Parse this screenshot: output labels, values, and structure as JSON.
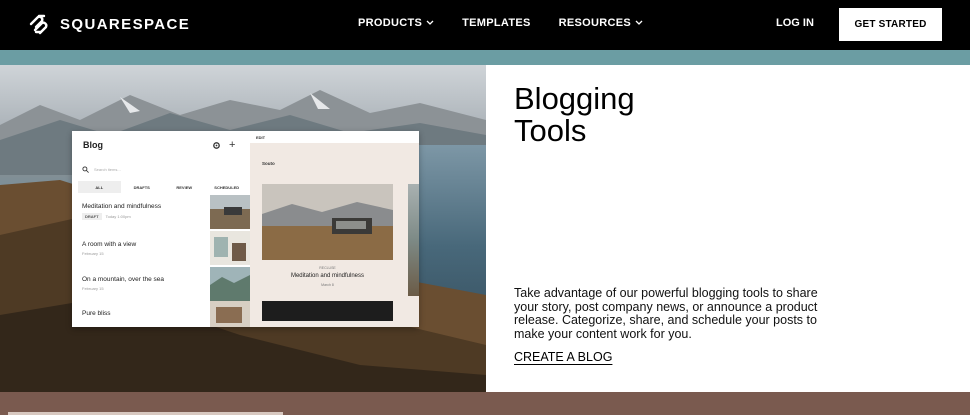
{
  "nav": {
    "brand": "SQUARESPACE",
    "links": [
      {
        "label": "PRODUCTS",
        "has_dropdown": true
      },
      {
        "label": "TEMPLATES",
        "has_dropdown": false
      },
      {
        "label": "RESOURCES",
        "has_dropdown": true
      }
    ],
    "login": "LOG IN",
    "cta": "GET STARTED"
  },
  "hero": {
    "app": {
      "title": "Blog",
      "search_placeholder": "Search items...",
      "tabs": [
        "ALL",
        "DRAFTS",
        "REVIEW",
        "SCHEDULED"
      ],
      "active_tab": "ALL",
      "posts": [
        {
          "title": "Meditation and mindfulness",
          "status": "DRAFT",
          "meta": "Today 1:00pm"
        },
        {
          "title": "A room with a view",
          "status": "",
          "meta": "February 15"
        },
        {
          "title": "On a mountain, over the sea",
          "status": "",
          "meta": "February 15"
        },
        {
          "title": "Pure bliss",
          "status": "",
          "meta": ""
        }
      ],
      "editor": {
        "bar_label": "EDIT",
        "site_name": "Souto",
        "category": "RECLUSE",
        "post_title": "Meditation and mindfulness",
        "post_date": "March 8"
      }
    }
  },
  "content": {
    "heading_line1": "Blogging",
    "heading_line2": "Tools",
    "body": "Take advantage of our powerful blogging tools to share your story, post company news, or announce a product release. Categorize, share, and schedule your posts to make your content work for you.",
    "link": "CREATE A BLOG"
  },
  "colors": {
    "nav_bg": "#000000",
    "teal_band": "#6b9da3",
    "bottom_band": "#7a5a4f"
  }
}
